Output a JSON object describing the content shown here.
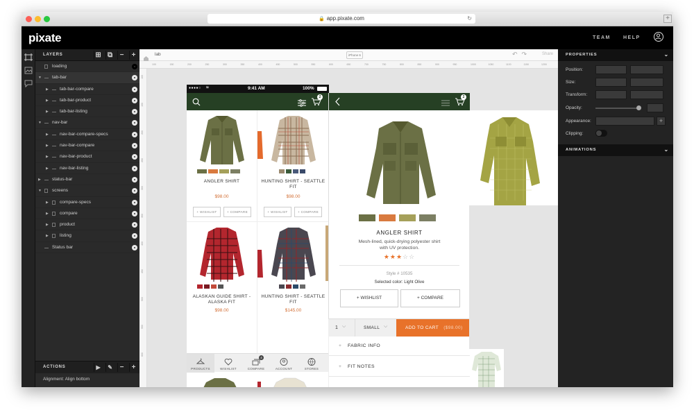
{
  "browser": {
    "url": "app.pixate.com"
  },
  "app": {
    "logo": "pixate",
    "nav": {
      "team": "TEAM",
      "help": "HELP"
    }
  },
  "layers": {
    "title": "LAYERS",
    "items": [
      {
        "name": "loading"
      },
      {
        "name": "tab-bar"
      },
      {
        "name": "tab-bar-compare"
      },
      {
        "name": "tab-bar-product"
      },
      {
        "name": "tab-bar-listing"
      },
      {
        "name": "nav-bar"
      },
      {
        "name": "nav-bar-compare-specs"
      },
      {
        "name": "nav-bar-compare"
      },
      {
        "name": "nav-bar-product"
      },
      {
        "name": "nav-bar-listing"
      },
      {
        "name": "status-bar"
      },
      {
        "name": "screens"
      },
      {
        "name": "compare-specs"
      },
      {
        "name": "compare"
      },
      {
        "name": "product"
      },
      {
        "name": "listing"
      },
      {
        "name": "Status bar"
      }
    ]
  },
  "actions": {
    "title": "ACTIONS",
    "item": "Alignment: Align bottom"
  },
  "canvas": {
    "breadcrumb": "lab",
    "device": "iPhone 6",
    "share": "Share",
    "ruler_x": [
      "100",
      "150",
      "200",
      "250",
      "300",
      "350",
      "400",
      "450",
      "500",
      "550",
      "600",
      "650",
      "700",
      "750",
      "800",
      "850",
      "900",
      "950",
      "1000",
      "1050",
      "1100",
      "1150",
      "1200",
      "1250"
    ],
    "ruler_y": [
      "100",
      "150",
      "200",
      "250",
      "300",
      "350",
      "400",
      "450",
      "500",
      "550",
      "600"
    ]
  },
  "phone": {
    "carrier": "●●●●○",
    "time": "9:41 AM",
    "battery": "100%",
    "cart_count": "2",
    "products": [
      {
        "name": "ANGLER SHIRT",
        "price": "$98.00"
      },
      {
        "name": "HUNTING SHIRT - SEATTLE FIT",
        "price": "$98.00"
      },
      {
        "name": "ALASKAN GUIDE SHIRT - ALASKA FIT",
        "price": "$98.00"
      },
      {
        "name": "HUNTING SHIRT - SEATTLE FIT",
        "price": "$145.00"
      }
    ],
    "wishlist_label": "+ WISHLIST",
    "compare_label": "+ COMPARE",
    "tabs": [
      {
        "label": "PRODUCTS"
      },
      {
        "label": "WISHLIST"
      },
      {
        "label": "COMPARE",
        "badge": "4"
      },
      {
        "label": "ACCOUNT"
      },
      {
        "label": "STORES"
      }
    ]
  },
  "product": {
    "name": "ANGLER SHIRT",
    "description": "Mesh-lined, quick-drying polyester shirt with UV protection.",
    "rating": 3,
    "rating_max": 5,
    "style": "Style # 10535",
    "selected_color": "Selected color: Light Olive",
    "wishlist": "+ WISHLIST",
    "compare": "+ COMPARE",
    "qty": "1",
    "size": "SMALL",
    "add_to_cart": "ADD TO CART",
    "cart_price": "($98.00)",
    "accordion": [
      "FABRIC INFO",
      "FIT NOTES"
    ]
  },
  "properties": {
    "title": "PROPERTIES",
    "labels": {
      "position": "Position:",
      "size": "Size:",
      "transform": "Transform:",
      "opacity": "Opacity:",
      "appearance": "Appearance:",
      "clipping": "Clipping:"
    },
    "animations_title": "ANIMATIONS"
  },
  "colors": {
    "nav_green": "#264024",
    "accent_orange": "#e8722a",
    "price_orange": "#d36f35",
    "swatches": [
      "#6b7045",
      "#d97a3f",
      "#a5a05a",
      "#7c7f63"
    ]
  }
}
